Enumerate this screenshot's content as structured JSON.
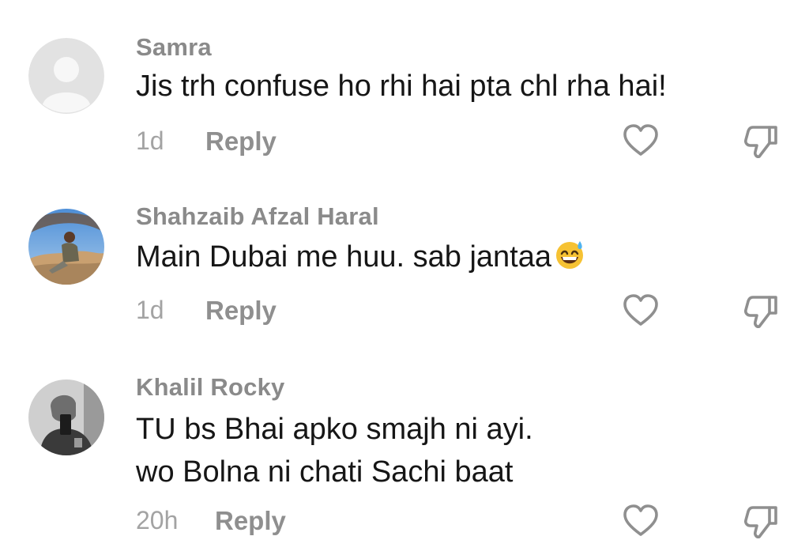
{
  "comments": [
    {
      "username": "Samra",
      "lines": [
        "Jis trh confuse ho rhi hai pta chl rha hai!"
      ],
      "time": "1d",
      "reply_label": "Reply",
      "avatar": "default-avatar"
    },
    {
      "username": "Shahzaib Afzal Haral",
      "lines": [
        "Main Dubai me huu. sab jantaa"
      ],
      "emoji": "grinning-sweat-emoji",
      "time": "1d",
      "reply_label": "Reply",
      "avatar": "photo-avatar-outdoor"
    },
    {
      "username": "Khalil Rocky",
      "lines": [
        "TU bs Bhai apko smajh ni ayi.",
        "wo Bolna ni chati Sachi baat"
      ],
      "time": "20h",
      "reply_label": "Reply",
      "avatar": "photo-avatar-selfie"
    }
  ],
  "icons": {
    "like": "heart-icon",
    "dislike": "thumbs-down-icon"
  },
  "colors": {
    "username": "#8a8a8a",
    "text": "#161616",
    "meta": "#a3a3a3",
    "icon": "#8f8f8f"
  }
}
